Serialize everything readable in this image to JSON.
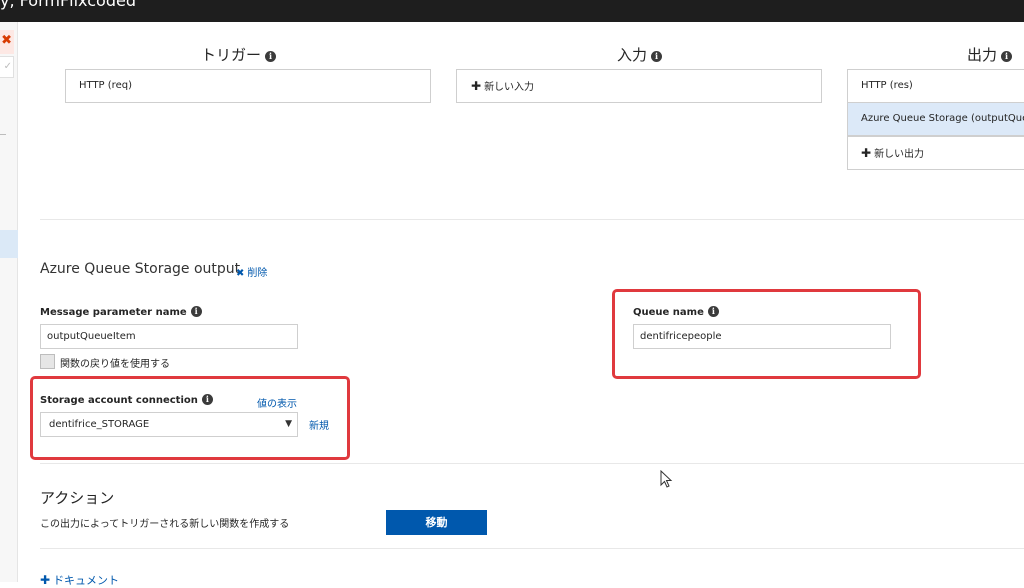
{
  "window": {
    "title": "y, FormFlixcoded"
  },
  "columns": {
    "trigger": {
      "title": "トリガー",
      "items": [
        "HTTP (req)"
      ]
    },
    "input": {
      "title": "入力",
      "new_label": "新しい入力"
    },
    "output": {
      "title": "出力",
      "items": [
        "HTTP (res)",
        "Azure Queue Storage (outputQueueItem)"
      ],
      "new_label": "新しい出力"
    }
  },
  "section": {
    "title": "Azure Queue Storage output",
    "delete_label": "削除"
  },
  "form": {
    "message_param_label": "Message parameter name",
    "message_param_value": "outputQueueItem",
    "use_return_label": "関数の戻り値を使用する",
    "storage_conn_label": "Storage account connection",
    "show_value_label": "値の表示",
    "storage_conn_value": "dentifrice_STORAGE",
    "new_label": "新規",
    "queue_name_label": "Queue name",
    "queue_name_value": "dentifricepeople"
  },
  "actions": {
    "title": "アクション",
    "description": "この出力によってトリガーされる新しい関数を作成する",
    "go_label": "移動"
  },
  "footer": {
    "doc_label": "ドキュメント"
  },
  "colors": {
    "accent": "#0058ad",
    "highlight": "#e0393e",
    "selected": "#dce9f8"
  }
}
